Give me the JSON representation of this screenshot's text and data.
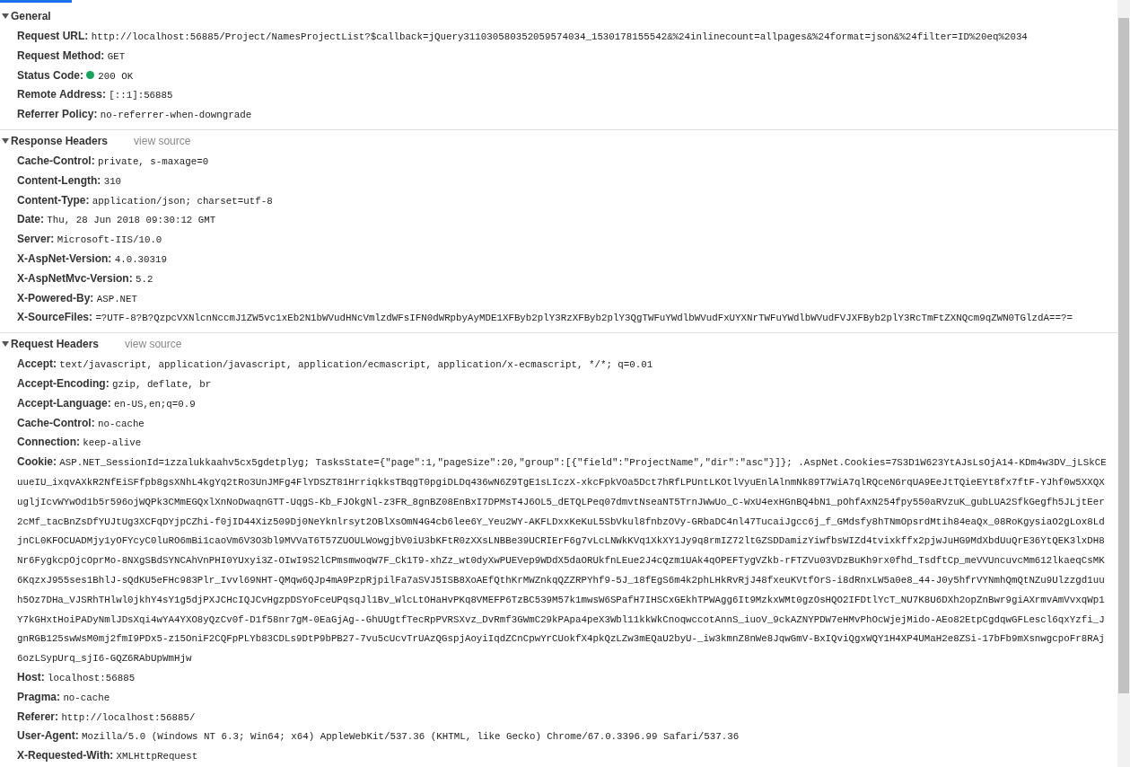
{
  "sections": [
    {
      "title": "General",
      "expanded": true,
      "rows": [
        {
          "name": "Request URL:",
          "value": "http://localhost:56885/Project/NamesProjectList?$callback=jQuery311030580352059574034_1530178155542&%24inlinecount=allpages&%24format=json&%24filter=ID%20eq%2034"
        },
        {
          "name": "Request Method:",
          "value": "GET"
        },
        {
          "name": "Status Code:",
          "value": "200 OK",
          "color": "#1aa260"
        },
        {
          "name": "Remote Address:",
          "value": "[::1]:56885"
        },
        {
          "name": "Referrer Policy:",
          "value": "no-referrer-when-downgrade"
        }
      ]
    },
    {
      "title": "Response Headers",
      "expanded": true,
      "link": "view source",
      "rows": [
        {
          "name": "Cache-Control:",
          "value": "private, s-maxage=0"
        },
        {
          "name": "Content-Length:",
          "value": "310"
        },
        {
          "name": "Content-Type:",
          "value": "application/json; charset=utf-8"
        },
        {
          "name": "Date:",
          "value": "Thu, 28 Jun 2018 09:30:12 GMT"
        },
        {
          "name": "Server:",
          "value": "Microsoft-IIS/10.0"
        },
        {
          "name": "X-AspNet-Version:",
          "value": "4.0.30319"
        },
        {
          "name": "X-AspNetMvc-Version:",
          "value": "5.2"
        },
        {
          "name": "X-Powered-By:",
          "value": "ASP.NET"
        },
        {
          "name": "X-SourceFiles:",
          "value": "=?UTF-8?B?QzpcVXNlcnNccmJ1ZW5vc1xEb2N1bWVudHNcVmlzdWFsIFN0dWRpbyAyMDE1XFByb2plY3RzXFByb2plY3QgTWFuYWdlbWVudFxUYXNrTWFuYWdlbWVudFVJXFByb2plY3RcTmFtZXNQcm9qZWN0TGlzdA==?="
        }
      ]
    },
    {
      "title": "Request Headers",
      "expanded": true,
      "link": "view source",
      "rows": [
        {
          "name": "Accept:",
          "value": "text/javascript, application/javascript, application/ecmascript, application/x-ecmascript, */*; q=0.01"
        },
        {
          "name": "Accept-Encoding:",
          "value": "gzip, deflate, br"
        },
        {
          "name": "Accept-Language:",
          "value": "en-US,en;q=0.9"
        },
        {
          "name": "Cache-Control:",
          "value": "no-cache"
        },
        {
          "name": "Connection:",
          "value": "keep-alive"
        },
        {
          "name": "Cookie:",
          "value": "ASP.NET_SessionId=1zzalukkaahv5cx5gdetplyg; TasksState={\"page\":1,\"pageSize\":20,\"group\":[{\"field\":\"ProjectName\",\"dir\":\"asc\"}]}; .AspNet.Cookies=7S3D1W623YtAJsLsOjA14-KDm4w3DV_jLSkCEuueIU_ixqvAXkR2NfEiSFfpb8gsXNhL4kgYq2tRo3UnJMFg4FlYDSZT81HrriqkksTBqgT0pgiDLDq436wN6Z9TgE1sLIczX-xkcFpkVOa5Dct7hRfLPUntLKOtlVyuEnlAlnmNk89T7WiA7qlRQceN6rqUA9EeJtTQieEYt8fx7ftF-YJhf0w5XXQXugljIcvWYwOd1b5r596ojWQPk3CMmEGQxlXnNoDwaqnGTT-UqgS-Kb_FJOkgNl-z3FR_8gnBZ08EnBxI7DPMsT4J6OL5_dETQLPeq07dmvtNseaNT5TrnJWwUo_C-WxU4exHGnBQ4bN1_pOhfAxN254fpy550aRVzuK_gubLUA2SfkGegfh5JLjtEer2cMf_tacBnZsDfYUJtUg3XCFqDYjpCZhi-f0jID44Xiz509Dj0NeYknlrsyt2OBlXsOmN4G4cb6lee6Y_Yeu2WY-AKFLDxxKeKuL5SbVkul8fnbzOVy-GRbaDC4nl47TucaiJgcc6j_f_GMdsfy8hTNmOpsrdMtih84eaQx_08RoKgysiaO2gLox8LdjnCL0KFOCUADMjy1yOFYcyC0luRO6mBi1caoVm6V3O3bl9MVVaT6T57ZUOULWowgjbV0iU3bKFtR0zXXsLNBBe39UCRIErF6g7vLcLNWkKVq1XkXY1Jy9q8rmIZ72ltGZSDDamizYiwfbsWIZd4tvixkffx2pjwJuHG9MdXbdUuQrE36YtQEK3lxDH8Nr6FygkcpOjcOprMo-8NXgSBdSYNCAhVnPHI0YUxyi3Z-OIwI9S2lCPmsmwoqW7F_Ck1T9-xhZz_wt0dyXwPUEVep9WDdX5daORUkfnLEue2J4cQzm1UAk4qOPEFTygVZkb-rFTZVu03VDzBuKh9rx0fhd_TsdftCp_meVVUncuvcMm612lkaeqCsMK6KqzxJ955ses1BhlJ-sQdKU5eFHc983Plr_Ivvl69NHT-QMqw6QJp4mA9PzpRjpilFa7aSVJ5ISB8XoAEfQthKrMWZnkqQZZRPYhf9-5J_18fEgS6m4k2phLHkRvRjJ48fxeuKVtfOrS-i8dRnxLW5a0e8_44-J0y5hfrVYNmhQmQtNZu9Ulzzgd1uuh5Oz7DHa_VJSRhTHlwl0jkhY4sY1g5djPXJCHcIQJCvHgzpDSYoFceUPqsqJl1Bv_WlcLtOHaHvPKq8VMEFP6TzBC539M57k1mwsW6SPafH7IHSCxGEkhTPWAgg6It9MzkxWMt0gzOsHQO2IFDtlYcT_NU7K8U6DXh2opZnBwr9giAXrmvAmVvxqWp1Y7kGHxtHoiPADyNmlJDsXqi4wYA4YXO8yQzCv0f-D1f58nr7gM-0EaGjAg--GhUUgtfTecRpPVRSXvz_DvRmf3GWmC29kPApa4peX3Wbl11kkWkCnoqwccotAnnS_iuoV_9ckAZNYPDW7eHMvPhOcWjejMido-AEo82EtpCgdqwGFLescl6qxYzfi_JgnRGB125swWsM0mj2fmI9PDx5-z15OniF2CQFpPLYb83CDLs9DtP9bPB27-7vu5cUcvTrUAzQGspjAoyiIqdZCnCpwYrCUokfX4pkQzLZw3mEQaU2byU-_iw3kmnZ8nWe8JqwGmV-BxIQviQgxWQY1H4XP4UMaH2e8ZSi-17bFb9mXsnwgcpoFr8RAj6ozLSypUrq_sjI6-GQZ6RAbUpWmHjw"
        },
        {
          "name": "Host:",
          "value": "localhost:56885"
        },
        {
          "name": "Pragma:",
          "value": "no-cache"
        },
        {
          "name": "Referer:",
          "value": "http://localhost:56885/"
        },
        {
          "name": "User-Agent:",
          "value": "Mozilla/5.0 (Windows NT 6.3; Win64; x64) AppleWebKit/537.36 (KHTML, like Gecko) Chrome/67.0.3396.99 Safari/537.36"
        },
        {
          "name": "X-Requested-With:",
          "value": "XMLHttpRequest"
        }
      ]
    }
  ]
}
